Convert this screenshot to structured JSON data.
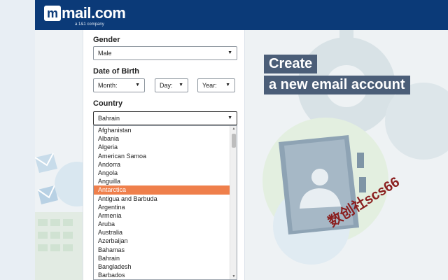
{
  "header": {
    "logo_text": "mail.com",
    "logo_tagline": "a 1&1 company"
  },
  "form": {
    "gender": {
      "label": "Gender",
      "value": "Male"
    },
    "birth": {
      "label": "Date of Birth",
      "month": "Month:",
      "day": "Day:",
      "year": "Year:"
    },
    "country": {
      "label": "Country",
      "value": "Bahrain",
      "options": [
        "Afghanistan",
        "Albania",
        "Algeria",
        "American Samoa",
        "Andorra",
        "Angola",
        "Anguilla",
        "Antarctica",
        "Antigua and Barbuda",
        "Argentina",
        "Armenia",
        "Aruba",
        "Australia",
        "Azerbaijan",
        "Bahamas",
        "Bahrain",
        "Bangladesh",
        "Barbados"
      ],
      "highlighted": "Antarctica"
    }
  },
  "hero": {
    "title_line1": "Create",
    "title_line2": "a new email account"
  },
  "watermark": "数创社scs66",
  "colors": {
    "header_bg": "#0b3a78",
    "highlight": "#ef7f4b",
    "title_bg": "#4b5e78"
  },
  "icons": [
    "envelope-icon",
    "gear-icon",
    "address-book-icon",
    "chevron-down-icon"
  ]
}
